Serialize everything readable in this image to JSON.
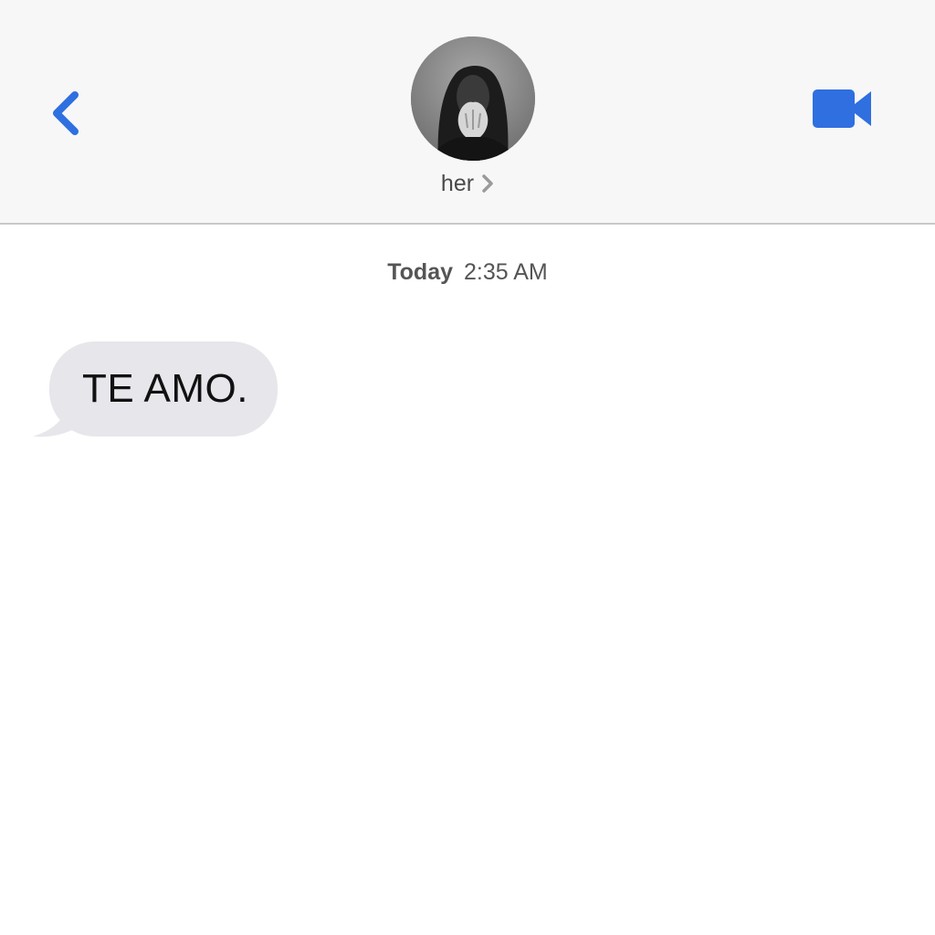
{
  "header": {
    "contact_name": "her",
    "back_icon": "chevron-left-icon",
    "video_icon": "video-camera-icon",
    "accent_color": "#2f6fe0"
  },
  "conversation": {
    "timestamp_day": "Today",
    "timestamp_time": "2:35 AM",
    "messages": [
      {
        "direction": "incoming",
        "text": "TE AMO."
      }
    ],
    "incoming_bubble_color": "#e6e6eb"
  }
}
